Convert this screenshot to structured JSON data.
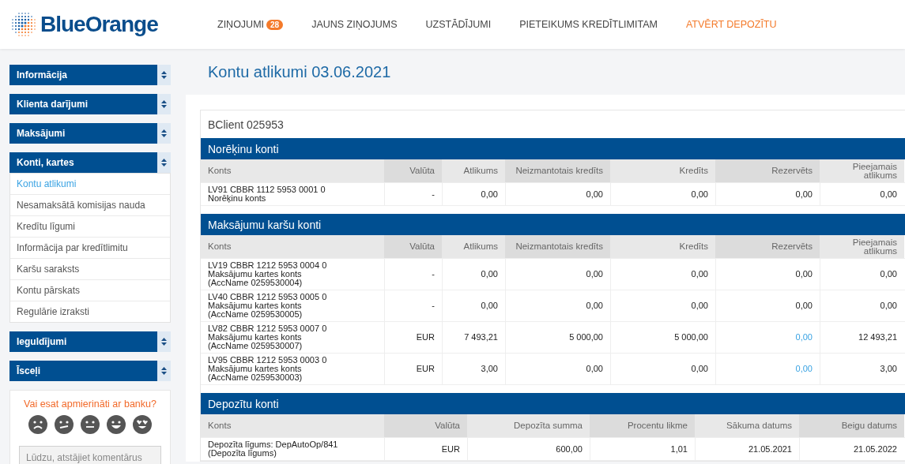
{
  "logo": {
    "text": "BlueOrange"
  },
  "nav": [
    {
      "label": "ZIŅOJUMI",
      "badge": "28",
      "highlight": false
    },
    {
      "label": "JAUNS ZIŅOJUMS",
      "highlight": false
    },
    {
      "label": "UZSTĀDĪJUMI",
      "highlight": false
    },
    {
      "label": "PIETEIKUMS KREDĪTLIMITAM",
      "highlight": false
    },
    {
      "label": "ATVĒRT DEPOZĪTU",
      "highlight": true
    }
  ],
  "sidebar": {
    "sections": [
      {
        "label": "Informācija"
      },
      {
        "label": "Klienta darījumi"
      },
      {
        "label": "Maksājumi"
      },
      {
        "label": "Konti, kartes",
        "children": [
          {
            "label": "Kontu atlikumi",
            "selected": true
          },
          {
            "label": "Nesamaksātā komisijas nauda",
            "selected": false
          },
          {
            "label": "Kredītu līgumi",
            "selected": false
          },
          {
            "label": "Informācija par kredītlimitu",
            "selected": false
          },
          {
            "label": "Karšu saraksts",
            "selected": false
          },
          {
            "label": "Kontu pārskats",
            "selected": false
          },
          {
            "label": "Regulārie izraksti",
            "selected": false
          }
        ]
      },
      {
        "label": "Ieguldījumi"
      },
      {
        "label": "Īsceļi"
      }
    ]
  },
  "feedback": {
    "question": "Vai esat apmierināti ar banku?",
    "faces": [
      {
        "kind": "sad"
      },
      {
        "kind": "unsure"
      },
      {
        "kind": "neutral"
      },
      {
        "kind": "happy"
      },
      {
        "kind": "love"
      }
    ],
    "comment": {
      "placeholder": "Lūdzu, atstājiet komentārus"
    }
  },
  "page_title": "Kontu atlikumi 03.06.2021",
  "client": "BClient 025953",
  "sections": [
    {
      "kind": "balances",
      "title": "Norēķinu konti",
      "columns": [
        "Konts",
        "Valūta",
        "Atlikums",
        "Neizmantotais kredīts",
        "Kredīts",
        "Rezervēts",
        "Pieejamais atlikums"
      ],
      "rows": [
        {
          "cells": [
            {
              "text": "LV91 CBBR 1112 5953 0001 0\nNorēķinu konts",
              "link": false
            },
            {
              "text": "-",
              "link": false
            },
            {
              "text": "0,00",
              "link": false
            },
            {
              "text": "0,00",
              "link": false
            },
            {
              "text": "0,00",
              "link": false
            },
            {
              "text": "0,00",
              "link": false
            },
            {
              "text": "0,00",
              "link": false
            }
          ]
        }
      ]
    },
    {
      "kind": "balances",
      "title": "Maksājumu karšu konti",
      "columns": [
        "Konts",
        "Valūta",
        "Atlikums",
        "Neizmantotais kredīts",
        "Kredīts",
        "Rezervēts",
        "Pieejamais atlikums"
      ],
      "rows": [
        {
          "cells": [
            {
              "text": "LV19 CBBR 1212 5953 0004 0\nMaksājumu kartes konts\n(AccName 0259530004)",
              "link": false
            },
            {
              "text": "-",
              "link": false
            },
            {
              "text": "0,00",
              "link": false
            },
            {
              "text": "0,00",
              "link": false
            },
            {
              "text": "0,00",
              "link": false
            },
            {
              "text": "0,00",
              "link": false
            },
            {
              "text": "0,00",
              "link": false
            }
          ]
        },
        {
          "cells": [
            {
              "text": "LV40 CBBR 1212 5953 0005 0\nMaksājumu kartes konts\n(AccName 0259530005)",
              "link": false
            },
            {
              "text": "-",
              "link": false
            },
            {
              "text": "0,00",
              "link": false
            },
            {
              "text": "0,00",
              "link": false
            },
            {
              "text": "0,00",
              "link": false
            },
            {
              "text": "0,00",
              "link": false
            },
            {
              "text": "0,00",
              "link": false
            }
          ]
        },
        {
          "cells": [
            {
              "text": "LV82 CBBR 1212 5953 0007 0\nMaksājumu kartes konts\n(AccName 0259530007)",
              "link": false
            },
            {
              "text": "EUR",
              "link": false
            },
            {
              "text": "7 493,21",
              "link": false
            },
            {
              "text": "5 000,00",
              "link": false
            },
            {
              "text": "5 000,00",
              "link": false
            },
            {
              "text": "0,00",
              "link": true
            },
            {
              "text": "12 493,21",
              "link": false
            }
          ]
        },
        {
          "cells": [
            {
              "text": "LV95 CBBR 1212 5953 0003 0\nMaksājumu kartes konts\n(AccName 0259530003)",
              "link": false
            },
            {
              "text": "EUR",
              "link": false
            },
            {
              "text": "3,00",
              "link": false
            },
            {
              "text": "0,00",
              "link": false
            },
            {
              "text": "0,00",
              "link": false
            },
            {
              "text": "0,00",
              "link": true
            },
            {
              "text": "3,00",
              "link": false
            }
          ]
        }
      ]
    },
    {
      "kind": "deposits",
      "title": "Depozītu konti",
      "columns": [
        "Konts",
        "Valūta",
        "Depozīta summa",
        "Procentu likme",
        "Sākuma datums",
        "Beigu datums"
      ],
      "rows": [
        {
          "cells": [
            {
              "text": "Depozīta līgums: DepAutoOp/841\n(Depozīta līgums)",
              "link": false
            },
            {
              "text": "EUR",
              "link": false
            },
            {
              "text": "600,00",
              "link": false
            },
            {
              "text": "1,01",
              "link": false
            },
            {
              "text": "21.05.2021",
              "link": false
            },
            {
              "text": "21.05.2022",
              "link": false
            }
          ]
        }
      ]
    }
  ]
}
